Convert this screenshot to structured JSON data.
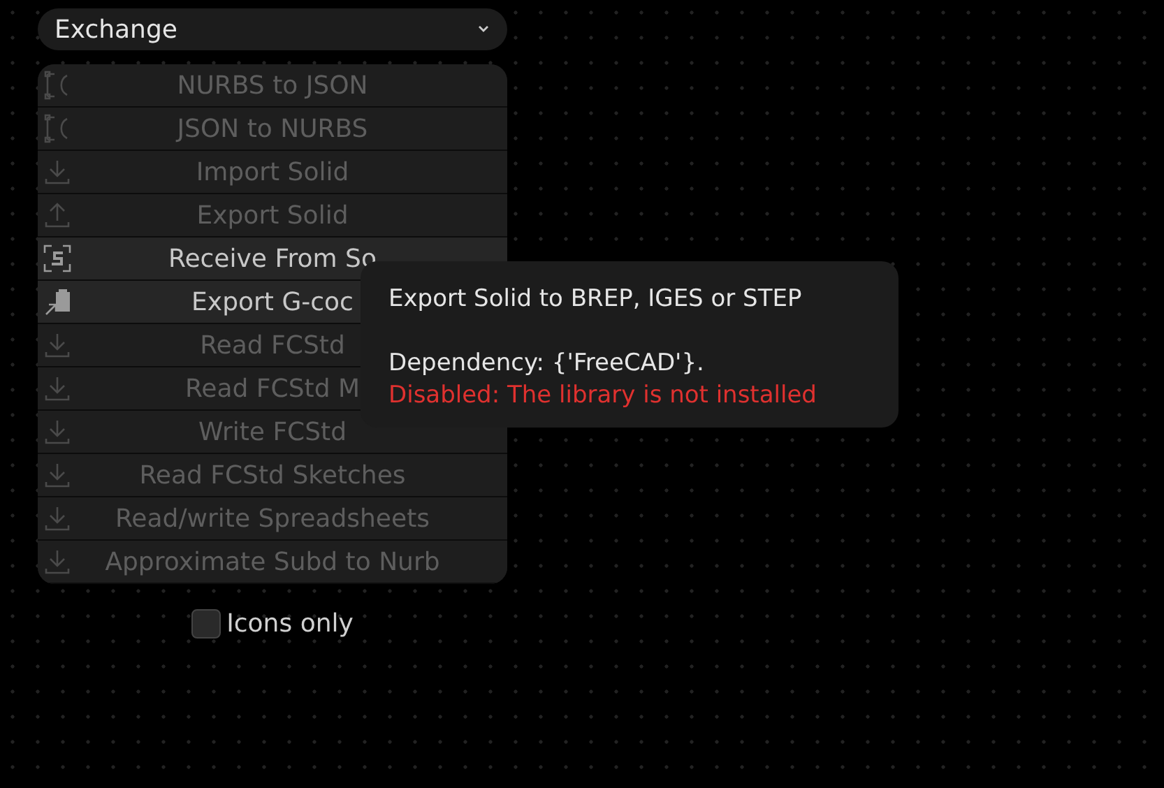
{
  "category_dropdown": {
    "value": "Exchange"
  },
  "nodes": [
    {
      "label": "NURBS to JSON",
      "kind": "nurbs",
      "disabled": true
    },
    {
      "label": "JSON to NURBS",
      "kind": "nurbs",
      "disabled": true
    },
    {
      "label": "Import Solid",
      "kind": "import",
      "disabled": true
    },
    {
      "label": "Export Solid",
      "kind": "export",
      "disabled": true
    },
    {
      "label": "Receive From So",
      "kind": "sorcar",
      "disabled": false
    },
    {
      "label": "Export G-coc",
      "kind": "gcode",
      "disabled": false
    },
    {
      "label": "Read FCStd",
      "kind": "import",
      "disabled": true
    },
    {
      "label": "Read FCStd M",
      "kind": "import",
      "disabled": true
    },
    {
      "label": "Write FCStd",
      "kind": "import",
      "disabled": true
    },
    {
      "label": "Read FCStd Sketches",
      "kind": "import",
      "disabled": true
    },
    {
      "label": "Read/write Spreadsheets",
      "kind": "import",
      "disabled": true
    },
    {
      "label": "Approximate Subd to Nurb",
      "kind": "import",
      "disabled": true
    }
  ],
  "icons_only": {
    "label": "Icons only",
    "checked": false
  },
  "tooltip": {
    "title": "Export Solid to BREP, IGES or STEP",
    "dependency": "Dependency: {'FreeCAD'}.",
    "warning": "Disabled: The library is not installed"
  }
}
